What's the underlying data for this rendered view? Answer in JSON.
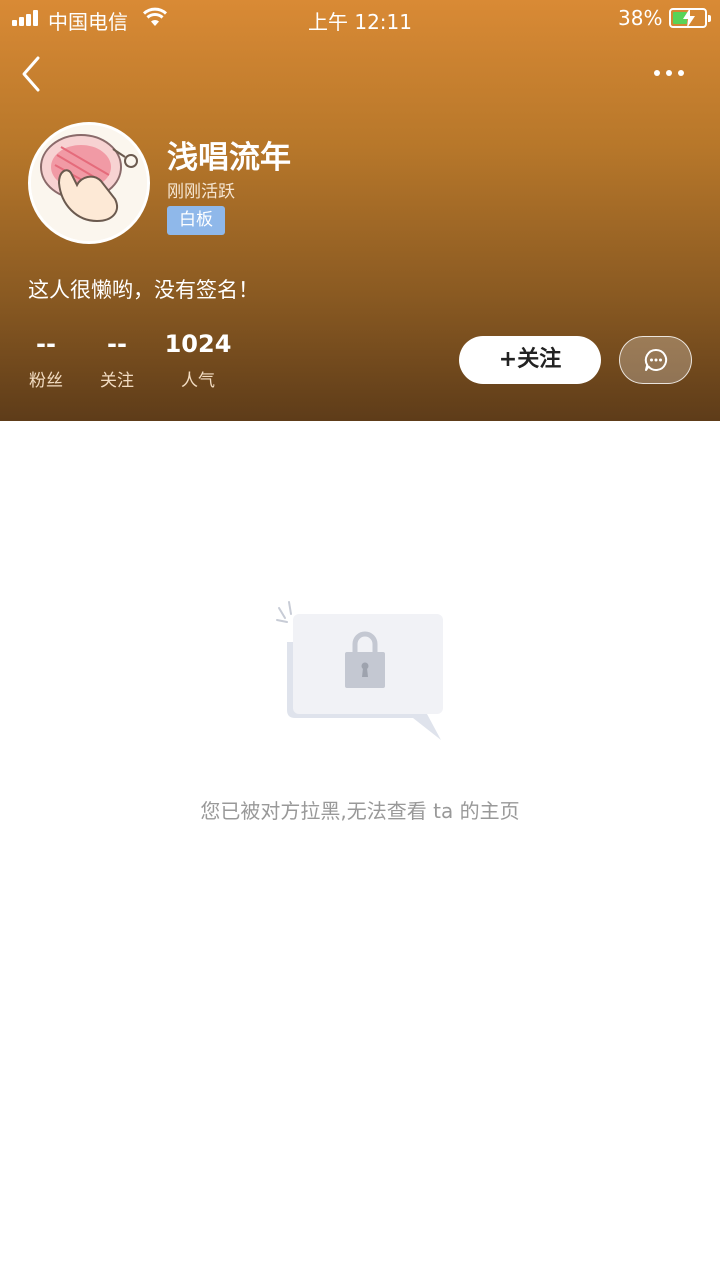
{
  "status_bar": {
    "carrier": "中国电信",
    "time": "上午 12:11",
    "battery_percent": "38%",
    "battery_level": 0.38
  },
  "profile": {
    "name": "浅唱流年",
    "active_status": "刚刚活跃",
    "tag": "白板",
    "signature": "这人很懒哟，没有签名！",
    "stats": [
      {
        "value": "--",
        "label": "粉丝"
      },
      {
        "value": "--",
        "label": "关注"
      },
      {
        "value": "1024",
        "label": "人气"
      }
    ]
  },
  "actions": {
    "follow_label": "+关注"
  },
  "empty_state": {
    "message": "您已被对方拉黑,无法查看 ta 的主页"
  },
  "colors": {
    "header_top": "#d98a35",
    "header_bottom": "#5e3c19",
    "tag_bg": "#8fb8ea",
    "hint_text": "#999999"
  }
}
